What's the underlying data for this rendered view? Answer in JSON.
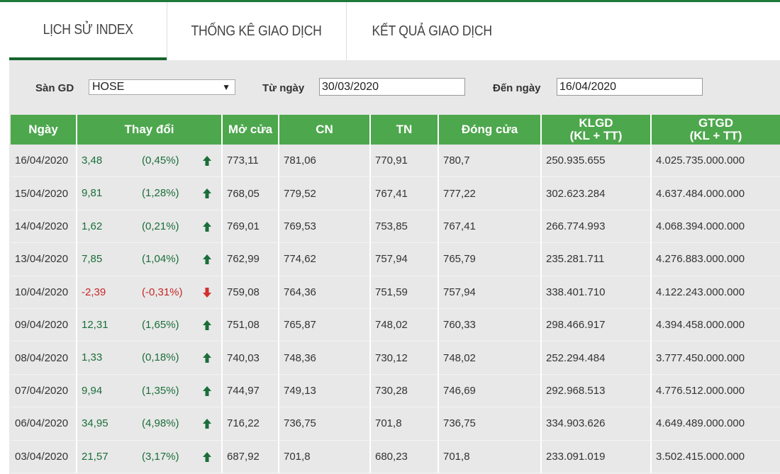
{
  "tabs": [
    {
      "label": "LỊCH SỬ INDEX",
      "active": true
    },
    {
      "label": "THỐNG KÊ GIAO DỊCH",
      "active": false
    },
    {
      "label": "KẾT QUẢ GIAO DỊCH",
      "active": false
    }
  ],
  "filters": {
    "exchange_label": "Sàn GD",
    "exchange_value": "HOSE",
    "from_label": "Từ ngày",
    "from_value": "30/03/2020",
    "to_label": "Đến ngày",
    "to_value": "16/04/2020"
  },
  "colors": {
    "header_green": "#4da74d",
    "up_green": "#1b6e3a",
    "down_red": "#c62828",
    "tab_underline": "#15652e"
  },
  "table": {
    "headers": {
      "date": "Ngày",
      "change": "Thay đổi",
      "open": "Mở cửa",
      "high": "CN",
      "low": "TN",
      "close": "Đóng cửa",
      "volume_line1": "KLGD",
      "volume_line2": "(KL + TT)",
      "value_line1": "GTGD",
      "value_line2": "(KL + TT)"
    },
    "rows": [
      {
        "date": "16/04/2020",
        "change": "3,48",
        "pct": "(0,45%)",
        "dir": "up",
        "open": "773,11",
        "high": "781,06",
        "low": "770,91",
        "close": "780,7",
        "volume": "250.935.655",
        "value": "4.025.735.000.000"
      },
      {
        "date": "15/04/2020",
        "change": "9,81",
        "pct": "(1,28%)",
        "dir": "up",
        "open": "768,05",
        "high": "779,52",
        "low": "767,41",
        "close": "777,22",
        "volume": "302.623.284",
        "value": "4.637.484.000.000"
      },
      {
        "date": "14/04/2020",
        "change": "1,62",
        "pct": "(0,21%)",
        "dir": "up",
        "open": "769,01",
        "high": "769,53",
        "low": "753,85",
        "close": "767,41",
        "volume": "266.774.993",
        "value": "4.068.394.000.000"
      },
      {
        "date": "13/04/2020",
        "change": "7,85",
        "pct": "(1,04%)",
        "dir": "up",
        "open": "762,99",
        "high": "774,62",
        "low": "757,94",
        "close": "765,79",
        "volume": "235.281.711",
        "value": "4.276.883.000.000"
      },
      {
        "date": "10/04/2020",
        "change": "-2,39",
        "pct": "(-0,31%)",
        "dir": "down",
        "open": "759,08",
        "high": "764,36",
        "low": "751,59",
        "close": "757,94",
        "volume": "338.401.710",
        "value": "4.122.243.000.000"
      },
      {
        "date": "09/04/2020",
        "change": "12,31",
        "pct": "(1,65%)",
        "dir": "up",
        "open": "751,08",
        "high": "765,87",
        "low": "748,02",
        "close": "760,33",
        "volume": "298.466.917",
        "value": "4.394.458.000.000"
      },
      {
        "date": "08/04/2020",
        "change": "1,33",
        "pct": "(0,18%)",
        "dir": "up",
        "open": "740,03",
        "high": "748,36",
        "low": "730,12",
        "close": "748,02",
        "volume": "252.294.484",
        "value": "3.777.450.000.000"
      },
      {
        "date": "07/04/2020",
        "change": "9,94",
        "pct": "(1,35%)",
        "dir": "up",
        "open": "744,97",
        "high": "749,13",
        "low": "730,28",
        "close": "746,69",
        "volume": "292.968.513",
        "value": "4.776.512.000.000"
      },
      {
        "date": "06/04/2020",
        "change": "34,95",
        "pct": "(4,98%)",
        "dir": "up",
        "open": "716,22",
        "high": "736,75",
        "low": "701,8",
        "close": "736,75",
        "volume": "334.903.626",
        "value": "4.649.489.000.000"
      },
      {
        "date": "03/04/2020",
        "change": "21,57",
        "pct": "(3,17%)",
        "dir": "up",
        "open": "687,92",
        "high": "701,8",
        "low": "680,23",
        "close": "701,8",
        "volume": "233.091.019",
        "value": "3.502.415.000.000"
      }
    ]
  }
}
